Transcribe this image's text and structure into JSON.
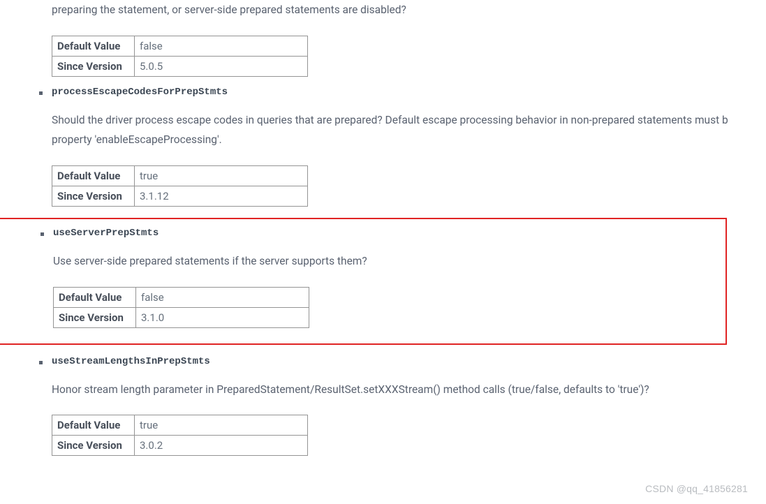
{
  "watermark": "CSDN @qq_41856281",
  "labels": {
    "default_value": "Default Value",
    "since_version": "Since Version"
  },
  "items": [
    {
      "name": "",
      "description_fragment": "preparing the statement, or server-side prepared statements are disabled?",
      "default_value": "false",
      "since_version": "5.0.5"
    },
    {
      "name": "processEscapeCodesForPrepStmts",
      "description": "Should the driver process escape codes in queries that are prepared? Default escape processing behavior in non-prepared statements must b property 'enableEscapeProcessing'.",
      "default_value": "true",
      "since_version": "3.1.12"
    },
    {
      "name": "useServerPrepStmts",
      "description": "Use server-side prepared statements if the server supports them?",
      "default_value": "false",
      "since_version": "3.1.0",
      "highlighted": true
    },
    {
      "name": "useStreamLengthsInPrepStmts",
      "description": "Honor stream length parameter in PreparedStatement/ResultSet.setXXXStream() method calls (true/false, defaults to 'true')?",
      "default_value": "true",
      "since_version": "3.0.2"
    }
  ]
}
